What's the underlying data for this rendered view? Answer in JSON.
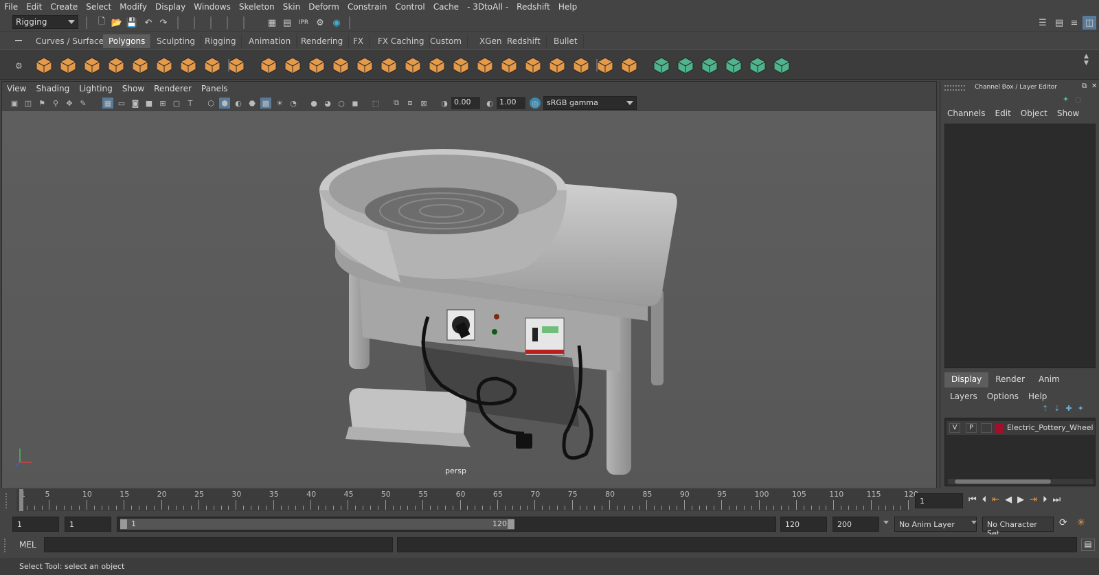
{
  "menubar": {
    "items": [
      "File",
      "Edit",
      "Create",
      "Select",
      "Modify",
      "Display",
      "Windows",
      "Skeleton",
      "Skin",
      "Deform",
      "Constrain",
      "Control",
      "Cache",
      "- 3DtoAll -",
      "Redshift",
      "Help"
    ]
  },
  "statusline": {
    "menuset": "Rigging"
  },
  "shelf": {
    "tabs": [
      "Curves / Surfaces",
      "Polygons",
      "Sculpting",
      "Rigging",
      "Animation",
      "Rendering",
      "FX",
      "FX Caching",
      "Custom",
      "XGen",
      "Redshift",
      "Bullet"
    ],
    "active_tab": "Polygons",
    "poly_icon_color": "#e59a4a",
    "tool_icon_color": "#4fb38c"
  },
  "viewport": {
    "menu": [
      "View",
      "Shading",
      "Lighting",
      "Show",
      "Renderer",
      "Panels"
    ],
    "exposure": "0.00",
    "gamma": "1.00",
    "colorspace": "sRGB gamma",
    "camera_label": "persp"
  },
  "rpanel": {
    "title": "Channel Box / Layer Editor",
    "channel_menu": [
      "Channels",
      "Edit",
      "Object",
      "Show"
    ],
    "layer_tabs": [
      "Display",
      "Render",
      "Anim"
    ],
    "active_layer_tab": "Display",
    "layer_menu": [
      "Layers",
      "Options",
      "Help"
    ],
    "layer": {
      "v": "V",
      "p": "P",
      "name": "Electric_Pottery_Wheel",
      "color": "#a0102a"
    }
  },
  "timeline": {
    "ticks": [
      "1",
      "5",
      "10",
      "15",
      "20",
      "25",
      "30",
      "35",
      "40",
      "45",
      "50",
      "55",
      "60",
      "65",
      "70",
      "75",
      "80",
      "85",
      "90",
      "95",
      "100",
      "105",
      "110",
      "115",
      "120"
    ],
    "current_frame": "1"
  },
  "range": {
    "start": "1",
    "anim_start": "1",
    "slider_start": "1",
    "slider_end": "120",
    "end": "120",
    "anim_end": "200",
    "anim_layer": "No Anim Layer",
    "character_set": "No Character Set"
  },
  "cmd": {
    "label": "MEL"
  },
  "help": {
    "text": "Select Tool: select an object"
  }
}
